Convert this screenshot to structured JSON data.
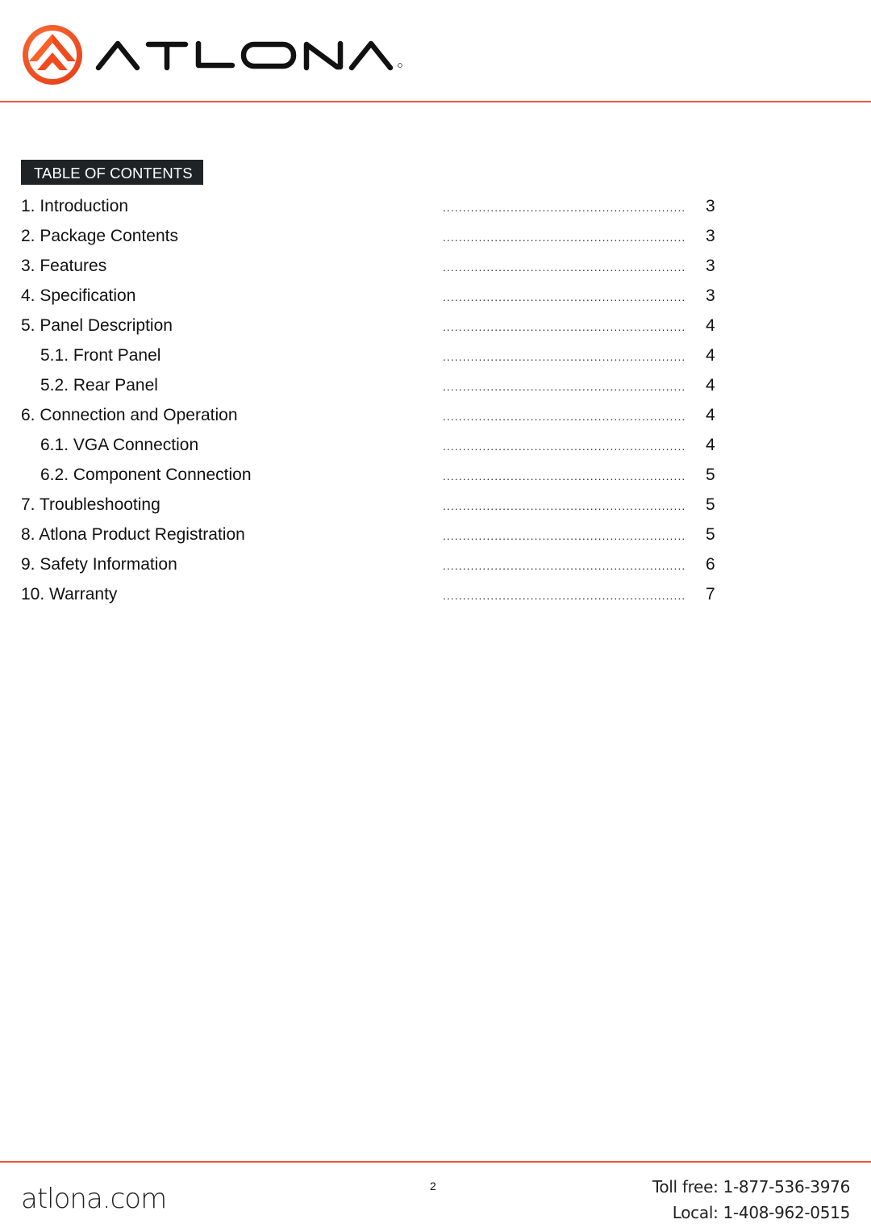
{
  "header": {
    "brand_name": "ATLONA",
    "logo_icon": "atlona-roof-logo-icon",
    "accent_color": "#f0553a"
  },
  "toc": {
    "heading": "TABLE OF CONTENTS",
    "items": [
      {
        "label": "1. Introduction",
        "page": "3",
        "level": 1
      },
      {
        "label": "2. Package Contents",
        "page": "3",
        "level": 1
      },
      {
        "label": "3. Features",
        "page": "3",
        "level": 1
      },
      {
        "label": "4. Specification",
        "page": "3",
        "level": 1
      },
      {
        "label": "5. Panel Description",
        "page": "4",
        "level": 1
      },
      {
        "label": "5.1. Front Panel",
        "page": "4",
        "level": 2
      },
      {
        "label": "5.2. Rear Panel",
        "page": "4",
        "level": 2
      },
      {
        "label": "6. Connection and Operation",
        "page": "4",
        "level": 1
      },
      {
        "label": "6.1. VGA Connection",
        "page": "4",
        "level": 2
      },
      {
        "label": "6.2. Component Connection",
        "page": "5",
        "level": 2
      },
      {
        "label": "7. Troubleshooting",
        "page": "5",
        "level": 1
      },
      {
        "label": "8. Atlona Product Registration",
        "page": "5",
        "level": 1
      },
      {
        "label": "9. Safety Information",
        "page": "6",
        "level": 1
      },
      {
        "label": "10. Warranty",
        "page": "7",
        "level": 1
      }
    ],
    "leader": "................................................................"
  },
  "footer": {
    "website": "atlona.com",
    "page_number": "2",
    "toll_free": "Toll free: 1-877-536-3976",
    "local": "Local: 1-408-962-0515"
  }
}
